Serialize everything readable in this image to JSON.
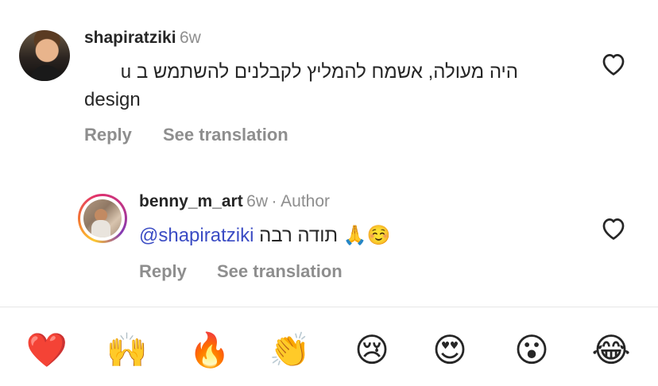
{
  "comments": [
    {
      "username": "shapiratziki",
      "time": "6w",
      "text_line1": "היה מעולה, אשמח להמליץ לקבלנים להשתמש ב u",
      "text_line2": "design",
      "reply_label": "Reply",
      "translate_label": "See translation"
    },
    {
      "username": "benny_m_art",
      "time": "6w",
      "author_badge": "· Author",
      "mention": "@shapiratziki",
      "text": "תודה רבה",
      "emojis": "🙏☺️",
      "reply_label": "Reply",
      "translate_label": "See translation"
    }
  ],
  "icons": {
    "like_comment_1": "heart-outline-icon",
    "like_comment_2": "heart-outline-icon"
  },
  "quick_reactions": [
    "❤️",
    "🙌",
    "🔥",
    "👏",
    "😢",
    "😍",
    "😮",
    "😂"
  ],
  "colors": {
    "mention": "#3b4cc4",
    "secondary_text": "#8e8e8e",
    "primary_text": "#262626"
  }
}
